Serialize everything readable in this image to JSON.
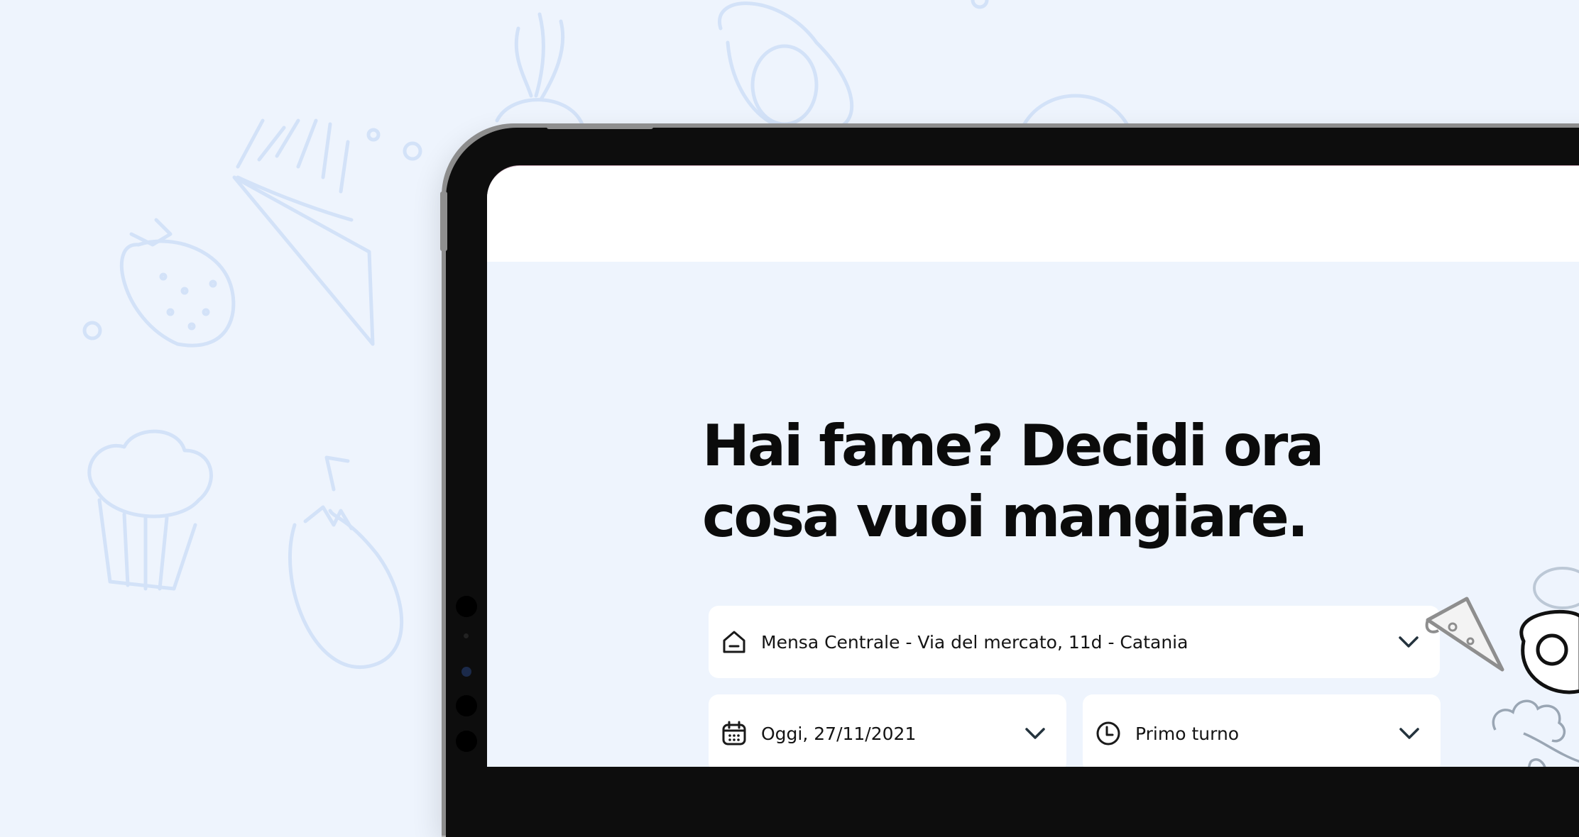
{
  "hero": {
    "headline": "Hai fame? Decidi  ora\ncosa vuoi mangiare."
  },
  "form": {
    "location": {
      "value": "Mensa Centrale - Via del mercato, 11d - Catania",
      "icon": "home-icon"
    },
    "date": {
      "value": "Oggi, 27/11/2021",
      "icon": "calendar-icon"
    },
    "shift": {
      "value": "Primo turno",
      "icon": "clock-icon"
    }
  },
  "colors": {
    "background": "#eef4fd",
    "doodle": "#d3e2f8",
    "field": "#ffffff",
    "text": "#0b0b0b",
    "chevron": "#24333d"
  }
}
